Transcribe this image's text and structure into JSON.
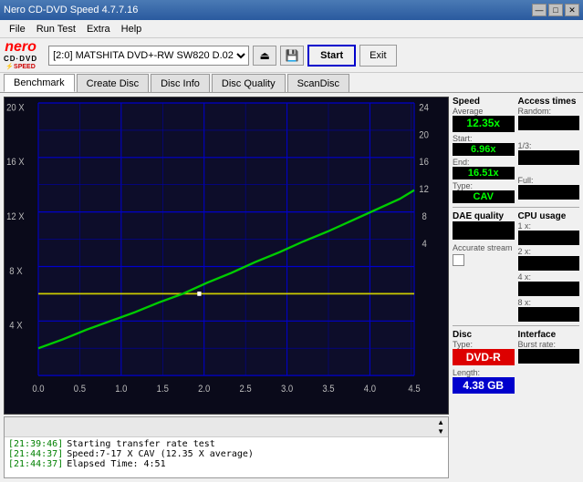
{
  "app": {
    "title": "Nero CD-DVD Speed 4.7.7.16",
    "titlebar_controls": [
      "—",
      "□",
      "✕"
    ]
  },
  "menubar": {
    "items": [
      "File",
      "Run Test",
      "Extra",
      "Help"
    ]
  },
  "toolbar": {
    "drive_value": "[2:0]  MATSHITA DVD+-RW SW820 D.02",
    "start_label": "Start",
    "exit_label": "Exit"
  },
  "tabs": [
    {
      "label": "Benchmark",
      "active": true
    },
    {
      "label": "Create Disc",
      "active": false
    },
    {
      "label": "Disc Info",
      "active": false
    },
    {
      "label": "Disc Quality",
      "active": false
    },
    {
      "label": "ScanDisc",
      "active": false
    }
  ],
  "chart": {
    "y_labels_left": [
      "20 X",
      "",
      "16 X",
      "",
      "12 X",
      "",
      "8 X",
      "",
      "4 X",
      ""
    ],
    "y_labels_right": [
      "24",
      "20",
      "",
      "16",
      "",
      "12",
      "",
      "8",
      "",
      "4"
    ],
    "x_labels": [
      "0.0",
      "0.5",
      "1.0",
      "1.5",
      "2.0",
      "2.5",
      "3.0",
      "3.5",
      "4.0",
      "4.5"
    ]
  },
  "speed_panel": {
    "title": "Speed",
    "average_label": "Average",
    "average_value": "12.35x",
    "start_label": "Start:",
    "start_value": "6.96x",
    "end_label": "End:",
    "end_value": "16.51x",
    "type_label": "Type:",
    "type_value": "CAV"
  },
  "access_times": {
    "title": "Access times",
    "random_label": "Random:",
    "random_value": "",
    "third_label": "1/3:",
    "third_value": "",
    "full_label": "Full:",
    "full_value": ""
  },
  "cpu_usage": {
    "title": "CPU usage",
    "x1_label": "1 x:",
    "x1_value": "",
    "x2_label": "2 x:",
    "x2_value": "",
    "x4_label": "4 x:",
    "x4_value": "",
    "x8_label": "8 x:",
    "x8_value": ""
  },
  "dae_quality": {
    "title": "DAE quality",
    "value": "",
    "accurate_stream_label": "Accurate stream",
    "checked": false
  },
  "disc": {
    "title": "Disc",
    "type_label": "Type:",
    "type_value": "DVD-R",
    "length_label": "Length:",
    "length_value": "4.38 GB"
  },
  "interface": {
    "title": "Interface",
    "burst_label": "Burst rate:",
    "burst_value": ""
  },
  "log": {
    "entries": [
      {
        "time": "[21:39:46]",
        "msg": "Starting transfer rate test"
      },
      {
        "time": "[21:44:37]",
        "msg": "Speed:7-17 X CAV (12.35 X average)"
      },
      {
        "time": "[21:44:37]",
        "msg": "Elapsed Time: 4:51"
      }
    ]
  }
}
